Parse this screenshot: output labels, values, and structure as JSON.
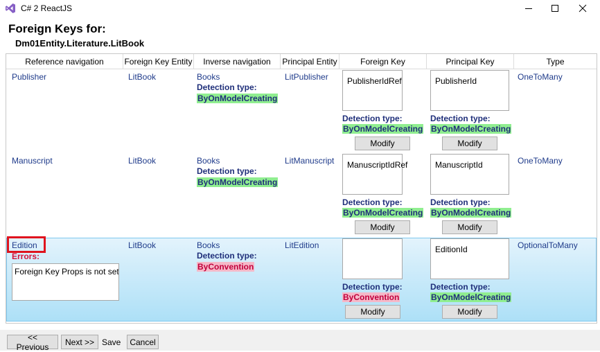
{
  "window": {
    "title": "C# 2 ReactJS",
    "icon": "visual-studio-icon",
    "min_icon": "minimize-icon",
    "max_icon": "maximize-icon",
    "close_icon": "close-icon"
  },
  "page": {
    "heading": "Foreign Keys for:",
    "entity": "Dm01Entity.Literature.LitBook"
  },
  "columns": [
    "Reference navigation",
    "Foreign Key Entity",
    "Inverse navigation",
    "Principal Entity",
    "Foreign Key",
    "Principal Key",
    "Type"
  ],
  "rows": [
    {
      "reference": "Publisher",
      "fk_entity": "LitBook",
      "inverse": "Books",
      "inverse_detection_label": "Detection type:",
      "inverse_detection_value": "ByOnModelCreating",
      "principal_entity": "LitPublisher",
      "foreign_key": "PublisherIdRef",
      "fk_detection_label": "Detection type:",
      "fk_detection_value": "ByOnModelCreating",
      "fk_modify": "Modify",
      "principal_key": "PublisherId",
      "pk_detection_label": "Detection type:",
      "pk_detection_value": "ByOnModelCreating",
      "pk_modify": "Modify",
      "type": "OneToMany"
    },
    {
      "reference": "Manuscript",
      "fk_entity": "LitBook",
      "inverse": "Books",
      "inverse_detection_label": "Detection type:",
      "inverse_detection_value": "ByOnModelCreating",
      "principal_entity": "LitManuscript",
      "foreign_key": "ManuscriptIdRef",
      "fk_detection_label": "Detection type:",
      "fk_detection_value": "ByOnModelCreating",
      "fk_modify": "Modify",
      "principal_key": "ManuscriptId",
      "pk_detection_label": "Detection type:",
      "pk_detection_value": "ByOnModelCreating",
      "pk_modify": "Modify",
      "type": "OneToMany"
    },
    {
      "reference": "Edition",
      "errors_label": "Errors:",
      "error_text": "Foreign Key Props is not set.",
      "fk_entity": "LitBook",
      "inverse": "Books",
      "inverse_detection_label": "Detection type:",
      "inverse_detection_value": "ByConvention",
      "principal_entity": "LitEdition",
      "foreign_key": "",
      "fk_detection_label": "Detection type:",
      "fk_detection_value": "ByConvention",
      "fk_modify": "Modify",
      "principal_key": "EditionId",
      "pk_detection_label": "Detection type:",
      "pk_detection_value": "ByOnModelCreating",
      "pk_modify": "Modify",
      "type": "OptionalToMany"
    }
  ],
  "footer": {
    "previous": "<< Previous",
    "next": "Next >>",
    "save": "Save",
    "cancel": "Cancel"
  },
  "colors": {
    "detection_ok": "#90ee90",
    "detection_warn": "#f5b8c8",
    "error": "#d4143c",
    "selected_row": "#ade0f7"
  }
}
